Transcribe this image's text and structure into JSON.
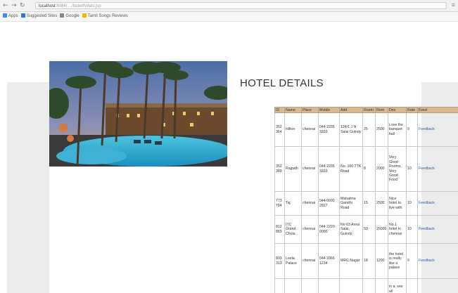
{
  "browser": {
    "back_icon": "arrow-left",
    "forward_icon": "arrow-right",
    "reload_icon": "reload",
    "url_host": "localhost",
    "url_rest": ":8084/..../hotel/hotels.jsp",
    "menu_icon": "hamburger"
  },
  "bookmarks": [
    {
      "label": "Apps",
      "color": "#4285f4"
    },
    {
      "label": "Suggested Sites",
      "color": "#2b7bd8"
    },
    {
      "label": "Google",
      "color": "#888888"
    },
    {
      "label": "Tamil Songs Reviews",
      "color": "#f4b400"
    }
  ],
  "page": {
    "title": "HOTEL DETAILS"
  },
  "table": {
    "columns": [
      "ID",
      "Name",
      "Place",
      "Mobile",
      "Add",
      "Room",
      "Rent",
      "Des",
      "Rate",
      "Feed"
    ],
    "rows": [
      [
        "352364",
        "Hilton",
        "chennai",
        "044 2235 3333",
        "124/1 J N Salai Guindy",
        "25",
        "2500",
        "Love the banquet hall",
        "9",
        "Feedback"
      ],
      [
        "352389",
        "Rajpath",
        "chennai",
        "044 2235 3333",
        "No. 166 TTK Road",
        "8",
        "2000",
        "Very Good Rooms, Very Good Food",
        "10",
        "Feedback"
      ],
      [
        "773784",
        "Taj",
        "chennai",
        "044 6600 2827",
        "Mahatma Gandhi Road",
        "15",
        "2500",
        "Nice hotel to live with",
        "10",
        "Feedback"
      ],
      [
        "812883",
        "ITC Grand Chola",
        "chennai",
        "044 2220 0000",
        "No 63 Anna Salai, Guindy",
        "50",
        "25000",
        "No.1 hotel in chennai",
        "10",
        "Feedback"
      ],
      [
        "803313",
        "Leela Palace",
        "chennai",
        "044 3366 1234",
        "MRC Nagar",
        "18",
        "1200",
        "the hotel is really like a palace",
        "9",
        "Feedback"
      ],
      [
        "",
        "",
        "",
        "",
        "",
        "",
        "",
        "in a, see all",
        "",
        ""
      ]
    ]
  }
}
